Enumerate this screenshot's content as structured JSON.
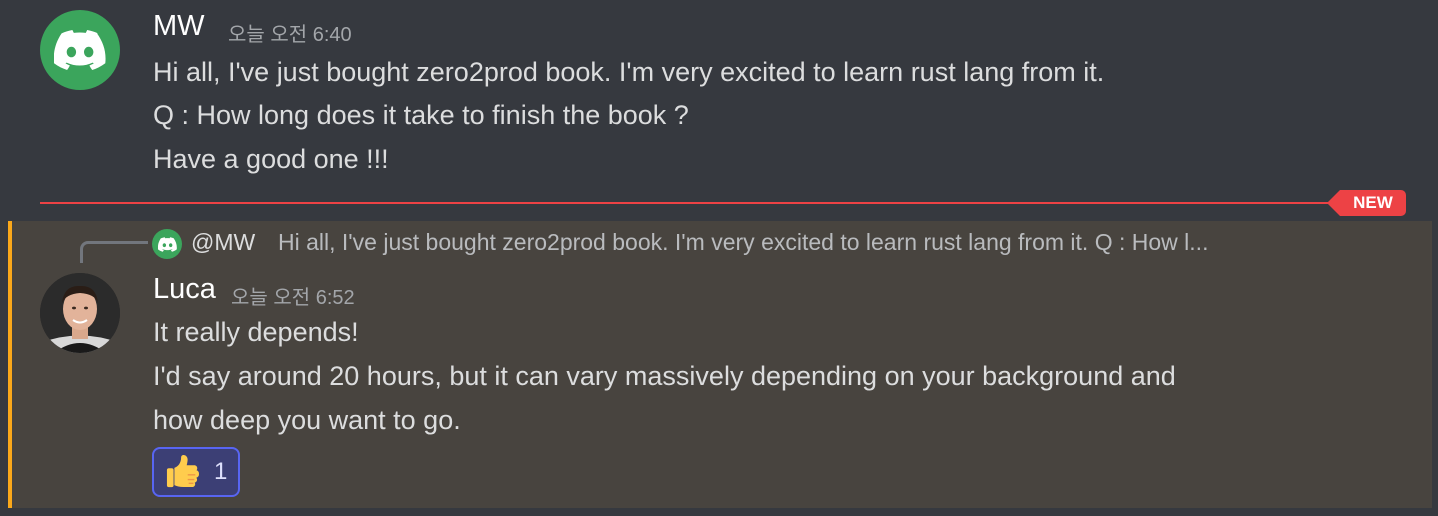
{
  "messages": [
    {
      "author": "MW",
      "timestamp": "오늘 오전 6:40",
      "avatar_icon": "discord-logo-icon",
      "avatar_color": "#3ba55c",
      "lines": [
        "Hi all, I've just bought zero2prod book. I'm very excited to learn rust lang from it.",
        "Q : How long does it take to finish the book ?",
        "Have a good one !!!"
      ]
    },
    {
      "author": "Luca",
      "timestamp": "오늘 오전 6:52",
      "avatar_icon": "user-photo-avatar",
      "reply": {
        "author": "@MW",
        "preview": "Hi all, I've just bought zero2prod book. I'm very excited to learn rust lang from it. Q : How l..."
      },
      "lines": [
        "It really depends!",
        "I'd say around 20 hours, but it can vary massively depending on your background and",
        "how deep you want to go."
      ],
      "reaction": {
        "emoji_icon": "thumbs-up-icon",
        "count": "1"
      }
    }
  ],
  "divider": {
    "label": "NEW",
    "color": "#ed4245"
  },
  "colors": {
    "background": "#36393f",
    "highlight": "#48443f",
    "mention_bar": "#faa81a",
    "reaction_border": "#5865f2"
  }
}
